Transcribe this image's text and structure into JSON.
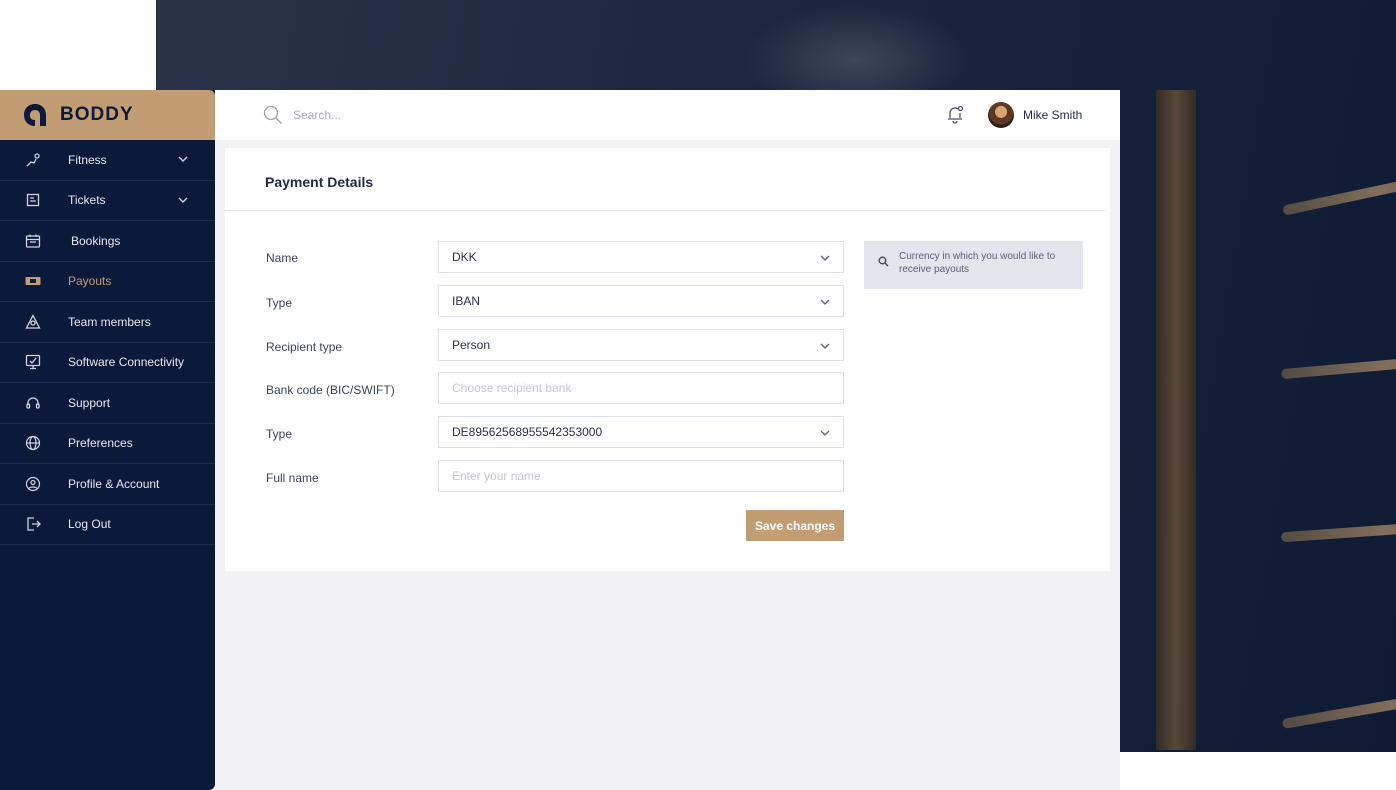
{
  "brand": {
    "name": "BODDY",
    "accent": "#c29d73",
    "sidebar_bg": "#0b1a3b"
  },
  "sidebar": {
    "items": [
      {
        "label": "Fitness",
        "icon": "fitness-icon",
        "has_submenu": true
      },
      {
        "label": "Tickets",
        "icon": "ticket-icon",
        "has_submenu": true
      },
      {
        "label": "Bookings",
        "icon": "calendar-icon",
        "has_submenu": false
      },
      {
        "label": "Payouts",
        "icon": "payout-icon",
        "has_submenu": false,
        "active": true
      },
      {
        "label": "Team members",
        "icon": "team-icon",
        "has_submenu": false
      },
      {
        "label": "Software Connectivity",
        "icon": "monitor-icon",
        "has_submenu": false
      },
      {
        "label": "Support",
        "icon": "headset-icon",
        "has_submenu": false
      },
      {
        "label": "Preferences",
        "icon": "globe-icon",
        "has_submenu": false
      },
      {
        "label": "Profile & Account",
        "icon": "user-circle-icon",
        "has_submenu": false
      },
      {
        "label": "Log Out",
        "icon": "logout-icon",
        "has_submenu": false
      }
    ]
  },
  "header": {
    "search_placeholder": "Search...",
    "user_name": "Mike Smith"
  },
  "payment": {
    "title": "Payment Details",
    "fields": [
      {
        "label": "Name",
        "value": "DKK",
        "kind": "select"
      },
      {
        "label": "Type",
        "value": "IBAN",
        "kind": "select"
      },
      {
        "label": "Recipient type",
        "value": "Person",
        "kind": "select"
      },
      {
        "label": "Bank code (BIC/SWIFT)",
        "placeholder": "Choose recipient bank",
        "kind": "input"
      },
      {
        "label": "Type",
        "value": "DE89562568955542353000",
        "kind": "select"
      },
      {
        "label": "Full name",
        "placeholder": "Enter your name",
        "kind": "input"
      }
    ],
    "tip": "Currency in which you would like to receive payouts",
    "save_label": "Save changes"
  }
}
